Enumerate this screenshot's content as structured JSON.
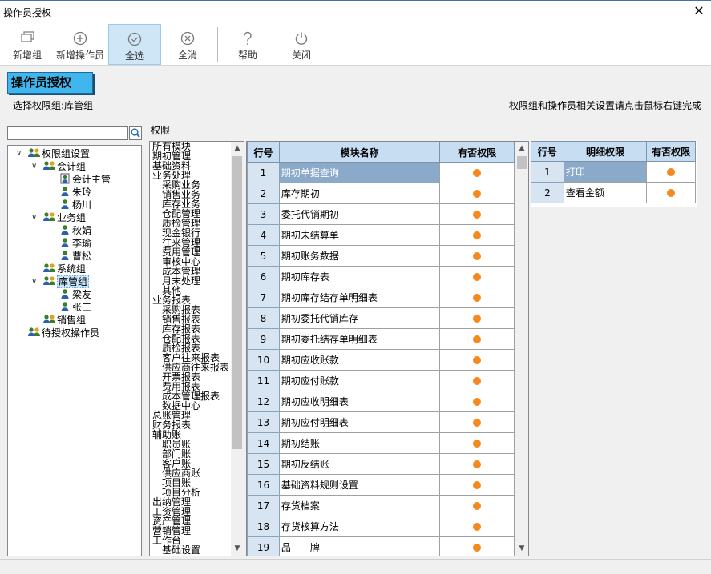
{
  "window": {
    "title": "操作员授权",
    "close_glyph": "✕"
  },
  "toolbar": [
    {
      "label": "新增组",
      "icon": "new-group-icon"
    },
    {
      "label": "新增操作员",
      "icon": "plus-circle-icon"
    },
    {
      "label": "全选",
      "icon": "check-circle-icon",
      "active": true
    },
    {
      "label": "全消",
      "icon": "x-circle-icon"
    },
    {
      "label": "帮助",
      "icon": "question-icon"
    },
    {
      "label": "关闭",
      "icon": "power-icon"
    }
  ],
  "heading": "操作员授权",
  "selected_group_text": "选择权限组:库管组",
  "hint_text": "权限组和操作员相关设置请点击鼠标右键完成",
  "search": {
    "value": ""
  },
  "tree": [
    {
      "label": "权限组设置",
      "level": 0,
      "expanded": true,
      "icon": "group-icon"
    },
    {
      "label": "会计组",
      "level": 1,
      "expanded": true,
      "icon": "group-icon"
    },
    {
      "label": "会计主管",
      "level": 2,
      "icon": "user-card-icon"
    },
    {
      "label": "朱玲",
      "level": 2,
      "icon": "user-icon"
    },
    {
      "label": "杨川",
      "level": 2,
      "icon": "user-icon"
    },
    {
      "label": "业务组",
      "level": 1,
      "expanded": true,
      "icon": "group-icon"
    },
    {
      "label": "秋娟",
      "level": 2,
      "icon": "user-icon"
    },
    {
      "label": "李瑜",
      "level": 2,
      "icon": "user-icon"
    },
    {
      "label": "曹松",
      "level": 2,
      "icon": "user-icon"
    },
    {
      "label": "系统组",
      "level": 1,
      "icon": "group-icon"
    },
    {
      "label": "库管组",
      "level": 1,
      "expanded": true,
      "icon": "group-icon",
      "selected": true
    },
    {
      "label": "梁友",
      "level": 2,
      "icon": "user-icon"
    },
    {
      "label": "张三",
      "level": 2,
      "icon": "user-icon"
    },
    {
      "label": "销售组",
      "level": 1,
      "icon": "group-icon"
    },
    {
      "label": "待授权操作员",
      "level": 0,
      "icon": "group-icon"
    }
  ],
  "permission_label": "权限",
  "modules": [
    {
      "label": "所有模块",
      "level": 0
    },
    {
      "label": "期初管理",
      "level": 0
    },
    {
      "label": "基础资料",
      "level": 0
    },
    {
      "label": "业务处理",
      "level": 0
    },
    {
      "label": "采购业务",
      "level": 1
    },
    {
      "label": "销售业务",
      "level": 1
    },
    {
      "label": "库存业务",
      "level": 1
    },
    {
      "label": "仓配管理",
      "level": 1
    },
    {
      "label": "质检管理",
      "level": 1
    },
    {
      "label": "现金银行",
      "level": 1
    },
    {
      "label": "往来管理",
      "level": 1
    },
    {
      "label": "费用管理",
      "level": 1
    },
    {
      "label": "审核中心",
      "level": 1
    },
    {
      "label": "成本管理",
      "level": 1
    },
    {
      "label": "月末处理",
      "level": 1
    },
    {
      "label": "其他",
      "level": 1
    },
    {
      "label": "业务报表",
      "level": 0
    },
    {
      "label": "采购报表",
      "level": 1
    },
    {
      "label": "销售报表",
      "level": 1
    },
    {
      "label": "库存报表",
      "level": 1
    },
    {
      "label": "仓配报表",
      "level": 1
    },
    {
      "label": "质检报表",
      "level": 1
    },
    {
      "label": "客户往来报表",
      "level": 1
    },
    {
      "label": "供应商往来报表",
      "level": 1
    },
    {
      "label": "开票报表",
      "level": 1
    },
    {
      "label": "费用报表",
      "level": 1
    },
    {
      "label": "成本管理报表",
      "level": 1
    },
    {
      "label": "数据中心",
      "level": 1
    },
    {
      "label": "总账管理",
      "level": 0
    },
    {
      "label": "财务报表",
      "level": 0
    },
    {
      "label": "辅助账",
      "level": 0
    },
    {
      "label": "职员账",
      "level": 1
    },
    {
      "label": "部门账",
      "level": 1
    },
    {
      "label": "客户账",
      "level": 1
    },
    {
      "label": "供应商账",
      "level": 1
    },
    {
      "label": "项目账",
      "level": 1
    },
    {
      "label": "项目分析",
      "level": 1
    },
    {
      "label": "出纳管理",
      "level": 0
    },
    {
      "label": "工资管理",
      "level": 0
    },
    {
      "label": "资产管理",
      "level": 0
    },
    {
      "label": "营销管理",
      "level": 0
    },
    {
      "label": "工作台",
      "level": 0
    },
    {
      "label": "基础设置",
      "level": 1
    }
  ],
  "module_table": {
    "headers": [
      "行号",
      "模块名称",
      "有否权限"
    ],
    "rows": [
      {
        "no": "1",
        "name": "期初单据查询",
        "selected": true
      },
      {
        "no": "2",
        "name": "库存期初"
      },
      {
        "no": "3",
        "name": "委托代销期初"
      },
      {
        "no": "4",
        "name": "期初未结算单"
      },
      {
        "no": "5",
        "name": "期初账务数据"
      },
      {
        "no": "6",
        "name": "期初库存表"
      },
      {
        "no": "7",
        "name": "期初库存结存单明细表"
      },
      {
        "no": "8",
        "name": "期初委托代销库存"
      },
      {
        "no": "9",
        "name": "期初委托结存单明细表"
      },
      {
        "no": "10",
        "name": "期初应收账款"
      },
      {
        "no": "11",
        "name": "期初应付账款"
      },
      {
        "no": "12",
        "name": "期初应收明细表"
      },
      {
        "no": "13",
        "name": "期初应付明细表"
      },
      {
        "no": "14",
        "name": "期初结账"
      },
      {
        "no": "15",
        "name": "期初反结账"
      },
      {
        "no": "16",
        "name": "基础资料规则设置"
      },
      {
        "no": "17",
        "name": "存货档案"
      },
      {
        "no": "18",
        "name": "存货核算方法"
      },
      {
        "no": "19",
        "name": "品　　牌"
      }
    ]
  },
  "detail_table": {
    "headers": [
      "行号",
      "明细权限",
      "有否权限"
    ],
    "rows": [
      {
        "no": "1",
        "name": "打印",
        "selected": true
      },
      {
        "no": "2",
        "name": "查看金额"
      }
    ]
  },
  "colors": {
    "accent": "#3fb6ee",
    "dot": "#f48a1f",
    "header": "#c7ddf2",
    "selected_row": "#8ba9c8"
  }
}
